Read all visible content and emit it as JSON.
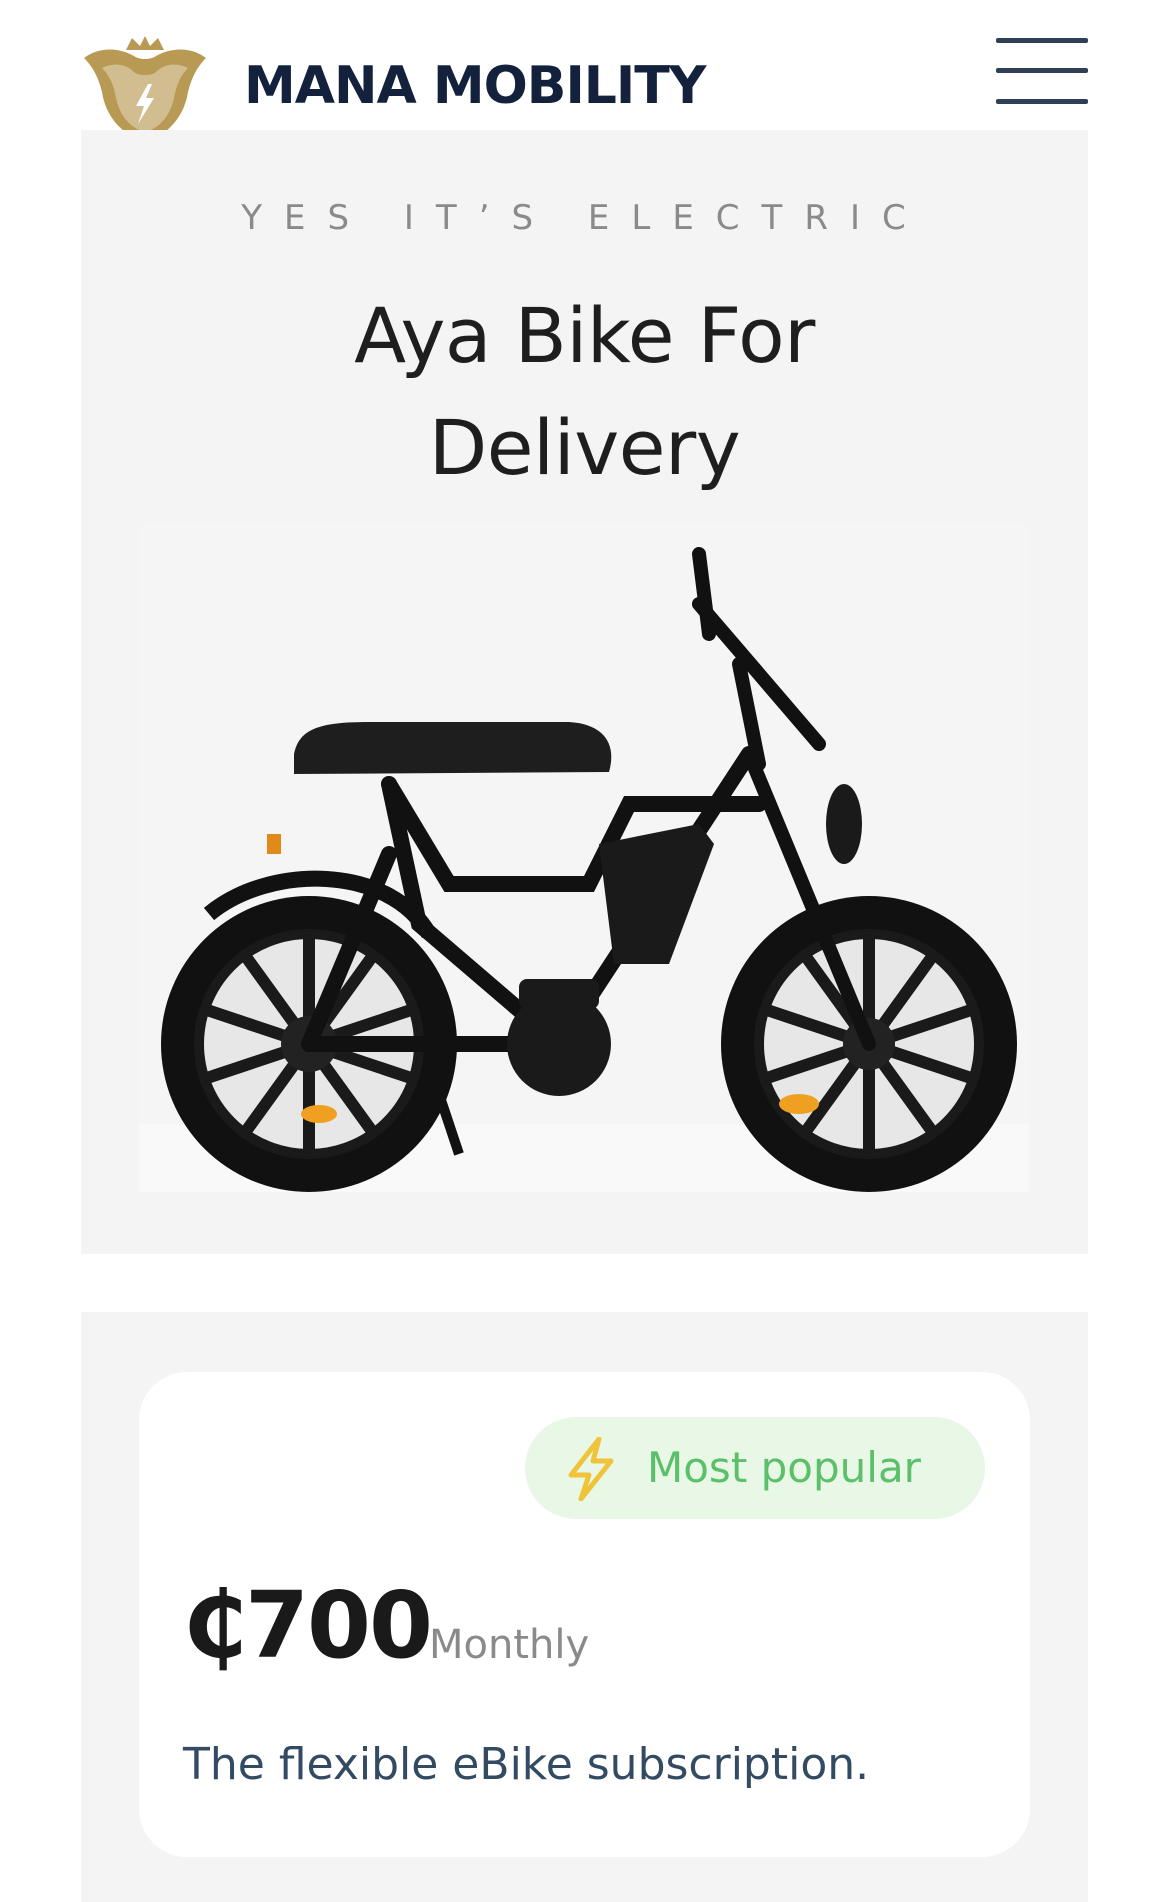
{
  "header": {
    "brand_name": "MANA MOBILITY",
    "logo_icon": "crown-shield-logo",
    "menu_icon": "hamburger-menu-icon"
  },
  "hero": {
    "eyebrow": "YES IT’S ELECTRIC",
    "title": "Aya Bike For Delivery",
    "image_subject": "black electric bike"
  },
  "pricing": {
    "badge": {
      "icon": "lightning-bolt-icon",
      "label": "Most popular"
    },
    "price": "₵700",
    "period": "Monthly",
    "description": "The flexible eBike subscription."
  },
  "colors": {
    "brand_navy": "#14213d",
    "logo_gold": "#b99a55",
    "badge_bg": "#e8f7e6",
    "badge_text": "#5cc06a",
    "badge_icon": "#f0c43a",
    "panel_bg": "#f4f4f4"
  }
}
